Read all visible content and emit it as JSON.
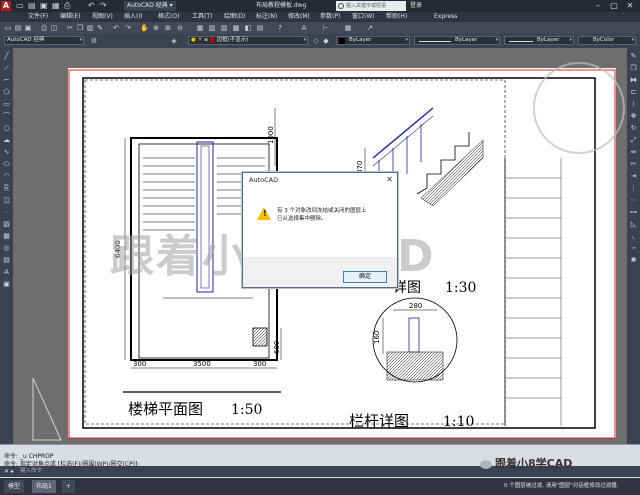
{
  "titlebar": {
    "logo": "A",
    "workspace": "AutoCAD 经典",
    "filename": "布局教程模板.dwg",
    "search_placeholder": "键入关键字或短语",
    "signin": "登录",
    "express": "Express"
  },
  "menu": [
    "文件(F)",
    "编辑(E)",
    "视图(V)",
    "插入(I)",
    "格式(O)",
    "工具(T)",
    "绘图(D)",
    "标注(N)",
    "修改(M)",
    "参数(P)",
    "窗口(W)",
    "帮助(H)"
  ],
  "toolbar": {
    "workspace_combo": "AutoCAD 经典",
    "layer_combo": "边框(不显示)",
    "color_combo": "ByLayer",
    "linetype_combo": "ByLayer",
    "lineweight_combo": "ByLayer",
    "plotstyle_combo": "ByColor"
  },
  "drawing": {
    "left_title": "楼梯平面图",
    "left_scale": "1:50",
    "right_title": "栏杆详图",
    "right_scale": "1:10",
    "mid_title_partial": "详图",
    "mid_scale": "1:30",
    "dims": {
      "d6400": "6400",
      "d1000": "1000",
      "d600": "600",
      "d300a": "300",
      "d3500": "3500",
      "d300b": "300",
      "d870": "870",
      "d280": "280",
      "d160": "160"
    }
  },
  "watermark": {
    "text": "跟着小8学CAD",
    "logo_text": "跟着小8学CAD"
  },
  "dialog": {
    "title": "AutoCAD",
    "line1": "有 3 个对象改到冻结或关闭的图层上",
    "line2": "已从选择集中删除。",
    "ok": "确定"
  },
  "command": {
    "history1": "命令: _u CHPROP",
    "history2": "命令: 指定对角点或 [栏选(F)/圈围(WP)/圈交(CP)]:",
    "placeholder": "键入命令"
  },
  "status": {
    "tab_model": "模型",
    "tab_layout": "布局1",
    "message": "0 个图层被过滤, 请用\"图层\"对话框修改过滤器."
  }
}
